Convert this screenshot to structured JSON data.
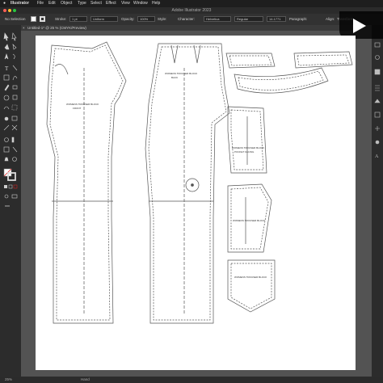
{
  "menubar": {
    "items": [
      "Illustrator",
      "File",
      "Edit",
      "Object",
      "Type",
      "Select",
      "Effect",
      "View",
      "Window",
      "Help"
    ]
  },
  "titlebar": {
    "title": "Adobe Illustrator 2023"
  },
  "controlbar": {
    "selection_status": "No Selection",
    "stroke_label": "Stroke:",
    "stroke_value": "1 pt",
    "brush_label": "Uniform",
    "opacity_label": "Opacity:",
    "opacity_value": "100%",
    "style_label": "Style:",
    "character_label": "Character:",
    "font_family": "Helvetica",
    "font_style": "Regular",
    "font_size": "14.1771",
    "paragraph_label": "Paragraph:",
    "align_label": "Align:",
    "transform_label": "Transform"
  },
  "document_tab": {
    "title": "Untitled-1* @ 25 % (CMYK/Preview)",
    "close": "×"
  },
  "statusbar": {
    "zoom": "25%",
    "tool_name": "Hand"
  },
  "pattern_pieces": {
    "front": [
      "WOMENS TROUSER BLOCK",
      "FRONT"
    ],
    "back": [
      "WOMENS TROUSER BLOCK",
      "BACK"
    ],
    "pocket_labels": [
      "WOMENS TROUSER BLOCK",
      "POCKET FACING"
    ],
    "grainline": "GRAIN LINE"
  },
  "colors": {
    "menubar_bg": "#1e1e1e",
    "panel_bg": "#2c2c2c",
    "canvas_bg": "#535353",
    "artboard": "#ffffff",
    "pattern_line": "#555555"
  }
}
